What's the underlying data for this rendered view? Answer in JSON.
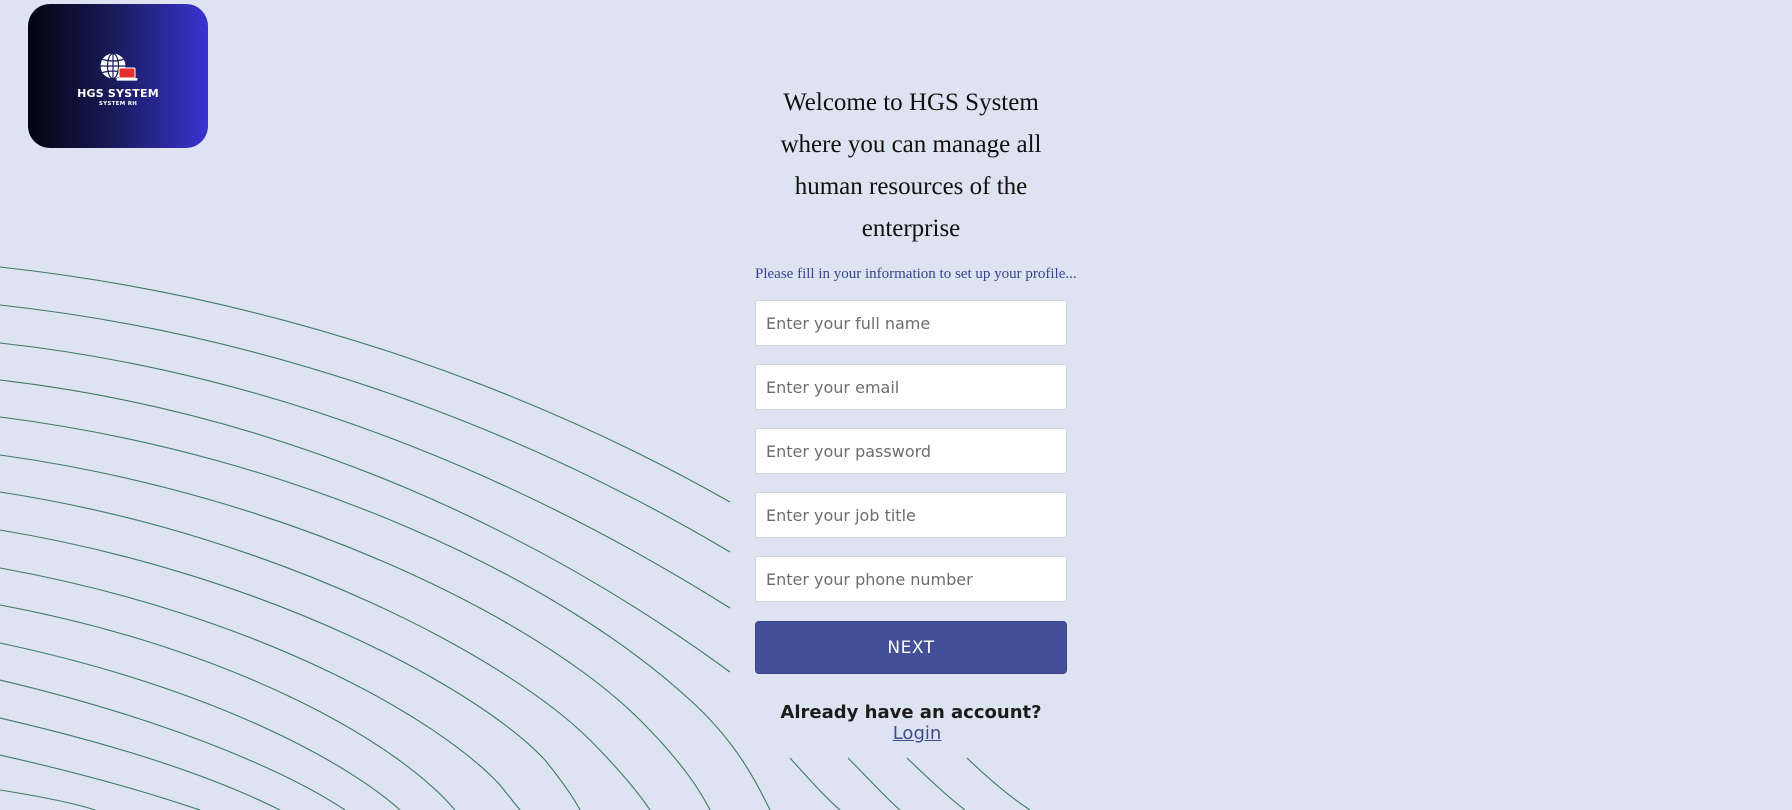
{
  "logo": {
    "title": "HGS SYSTEM",
    "subtitle": "SYSTEM RH",
    "icon": "globe-laptop-icon"
  },
  "welcome": {
    "heading": "Welcome to HGS System where you can manage all human resources of the enterprise",
    "instruction": "Please fill in your information to set up your profile..."
  },
  "form": {
    "full_name_placeholder": "Enter your full name",
    "email_placeholder": "Enter your email",
    "password_placeholder": "Enter your password",
    "job_title_placeholder": "Enter your job title",
    "phone_placeholder": "Enter your phone number",
    "next_label": "NEXT"
  },
  "footer": {
    "account_question": "Already have an account?",
    "login_label": "Login"
  },
  "colors": {
    "background": "#dde3f0",
    "accent": "#434f96",
    "link": "#3f4a90",
    "wave_lines": "#3f7a62"
  }
}
